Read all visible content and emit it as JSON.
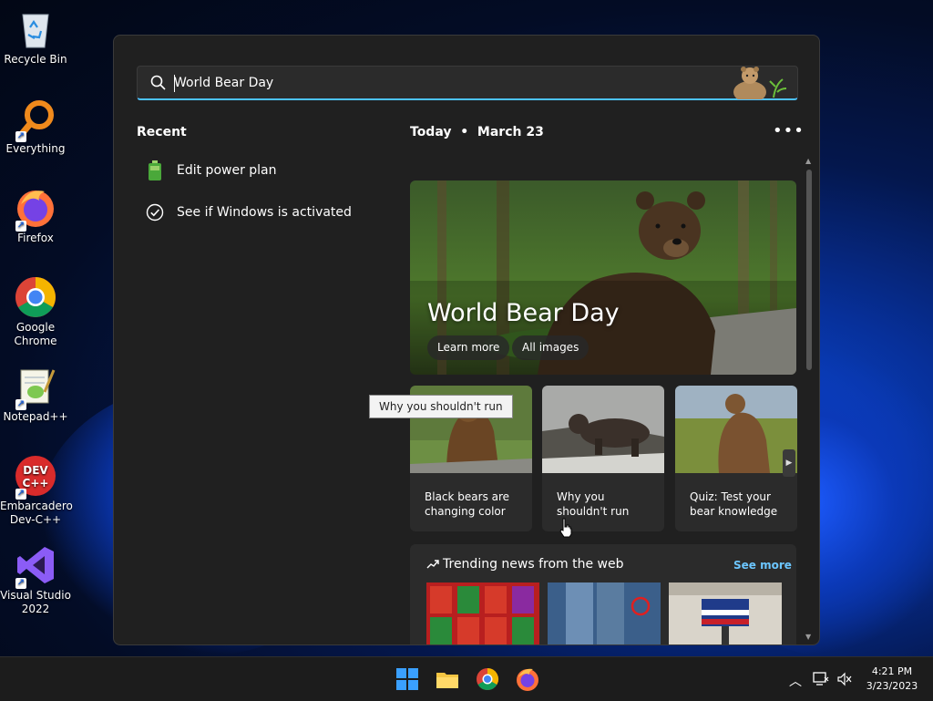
{
  "desktop": {
    "icons": [
      {
        "label": "Recycle Bin"
      },
      {
        "label": "Everything"
      },
      {
        "label": "Firefox"
      },
      {
        "label": "Google Chrome"
      },
      {
        "label": "Notepad++"
      },
      {
        "label": "Embarcadero Dev-C++"
      },
      {
        "label": "Visual Studio 2022"
      }
    ]
  },
  "search": {
    "value": "World Bear Day"
  },
  "recent": {
    "title": "Recent",
    "items": [
      {
        "label": "Edit power plan",
        "icon": "battery-icon"
      },
      {
        "label": "See if Windows is activated",
        "icon": "check-circle-icon"
      }
    ]
  },
  "today": {
    "header": "Today  •  March 23",
    "more_label": "•••"
  },
  "hero": {
    "title": "World Bear Day",
    "learn_more": "Learn more",
    "all_images": "All images"
  },
  "cards": [
    {
      "caption": "Black bears are changing color"
    },
    {
      "caption": "Why you shouldn't run"
    },
    {
      "caption": "Quiz: Test your bear knowledge"
    }
  ],
  "tooltip": "Why you shouldn't run",
  "trending": {
    "title": "Trending news from the web",
    "see_more": "See more"
  },
  "taskbar": {
    "time": "4:21 PM",
    "date": "3/23/2023"
  },
  "colors": {
    "accent": "#4cc2ff",
    "panel": "#202020",
    "card": "#2b2b2b",
    "link": "#6cc6ff"
  }
}
